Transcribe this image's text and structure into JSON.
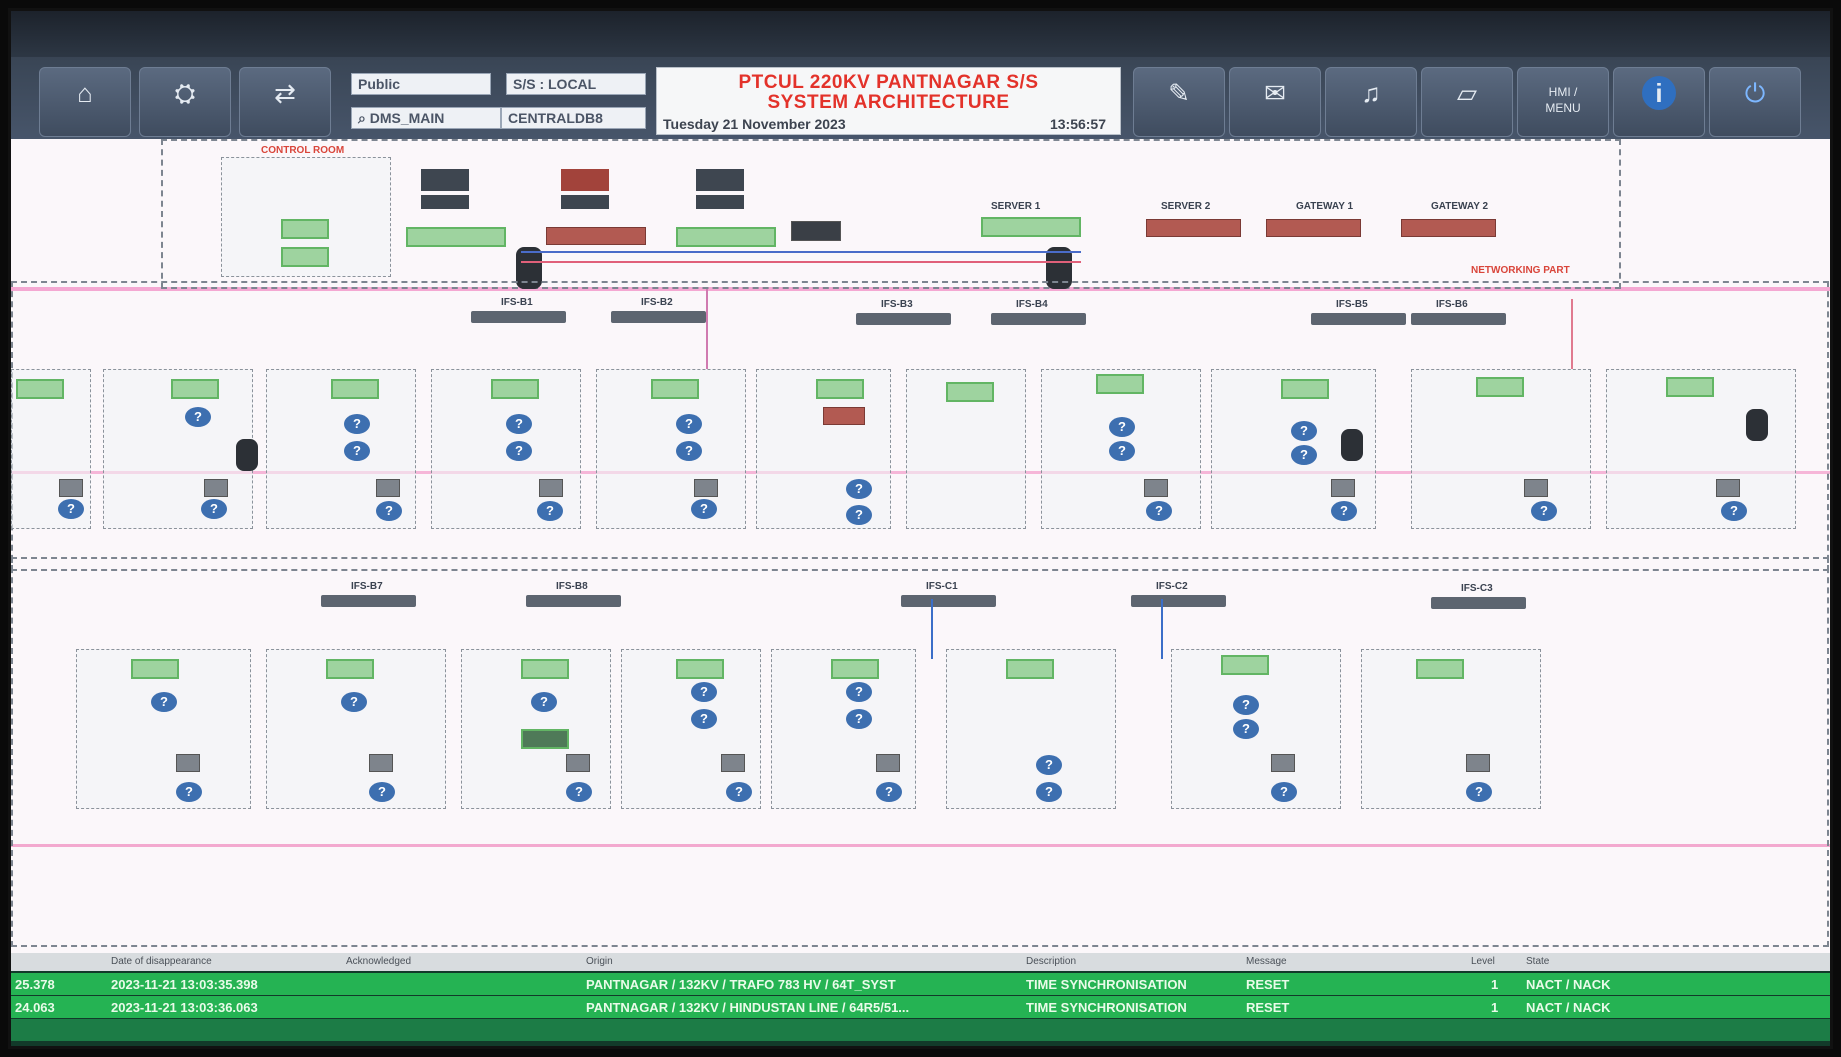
{
  "toolbar": {
    "user_field": "Public",
    "ss_field": "S/S :   LOCAL",
    "search_field": "DMS_MAIN",
    "centralized_field": "CENTRALDB8",
    "title_line1": "PTCUL 220KV PANTNAGAR S/S",
    "title_line2": "SYSTEM ARCHITECTURE",
    "datetime": "Tuesday 21 November 2023",
    "clock": "13:56:57",
    "info_button": "i",
    "left_buttons": [
      "home-icon",
      "network-icon",
      "sync-icon"
    ],
    "right_buttons": [
      {
        "icon": "signature-icon",
        "label": ""
      },
      {
        "icon": "mail-icon",
        "label": ""
      },
      {
        "icon": "bell-icon",
        "label": ""
      },
      {
        "icon": "eraser-icon",
        "label": ""
      },
      {
        "icon": "hmi-icon",
        "label": "HMI / MENU"
      },
      {
        "icon": "info-icon",
        "label": ""
      },
      {
        "icon": "power-icon",
        "label": ""
      }
    ]
  },
  "diagram": {
    "control_room_label": "CONTROL ROOM",
    "networking_label": "NETWORKING PART",
    "server1": "SERVER 1",
    "server2": "SERVER 2",
    "gateway1": "GATEWAY 1",
    "gateway2": "GATEWAY 2",
    "switch_labels_row1": [
      "IFS-B1",
      "IFS-B2",
      "IFS-B3",
      "IFS-B4",
      "IFS-B5",
      "IFS-B6"
    ],
    "switch_labels_row2": [
      "IFS-B7",
      "IFS-B8",
      "IFS-C1",
      "IFS-C2",
      "IFS-C3"
    ]
  },
  "alarms": {
    "headers": [
      "Date of disappearance",
      "Acknowledged",
      "Origin",
      "Description",
      "Message",
      "Level",
      "State"
    ],
    "rows": [
      {
        "id": "25.378",
        "date": "2023-11-21 13:03:35.398",
        "origin": "PANTNAGAR / 132KV / TRAFO 783 HV / 64T_SYST",
        "description": "TIME SYNCHRONISATION",
        "message": "RESET",
        "level": "1",
        "state": "NACT / NACK"
      },
      {
        "id": "24.063",
        "date": "2023-11-21 13:03:36.063",
        "origin": "PANTNAGAR / 132KV / HINDUSTAN LINE / 64R5/51...",
        "description": "TIME SYNCHRONISATION",
        "message": "RESET",
        "level": "1",
        "state": "NACT / NACK"
      }
    ]
  },
  "colors": {
    "title_red": "#e3322a",
    "alarm_green": "#25b353",
    "device_green": "#9ed39f",
    "help_blue": "#3d6fb0"
  }
}
